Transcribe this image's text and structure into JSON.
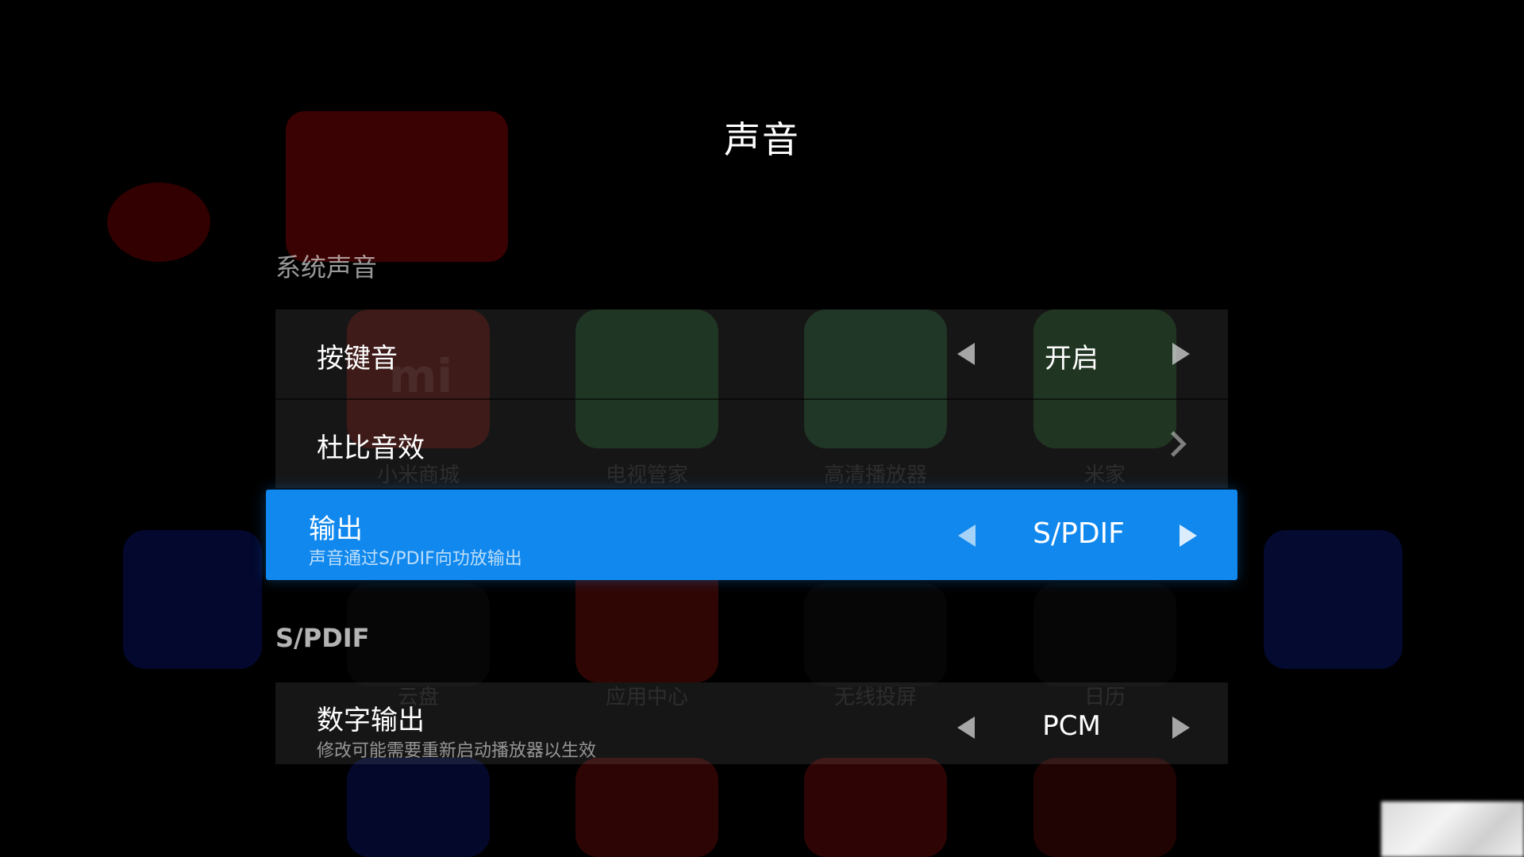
{
  "header": {
    "title": "声音"
  },
  "sections": {
    "system": {
      "title": "系统声音",
      "rows": {
        "key_sound": {
          "label": "按键音",
          "value": "开启"
        },
        "dolby": {
          "label": "杜比音效"
        },
        "output": {
          "label": "输出",
          "subtitle": "声音通过S/PDIF向功放输出",
          "value": "S/PDIF"
        }
      }
    },
    "spdif": {
      "title": "S/PDIF",
      "rows": {
        "digital_output": {
          "label": "数字输出",
          "subtitle": "修改可能需要重新启动播放器以生效",
          "value": "PCM"
        }
      }
    }
  },
  "background_apps": {
    "row1": [
      "小米商城",
      "电视管家",
      "高清播放器",
      "米家"
    ],
    "row2": [
      "云盘",
      "应用中心",
      "无线投屏",
      "日历"
    ]
  },
  "colors": {
    "background": "#000000",
    "focus_highlight": "#1088ee",
    "group_background": "rgba(255,255,255,0.085)"
  },
  "icons": {
    "left_arrow": "left-triangle-arrow-icon",
    "right_arrow": "right-triangle-arrow-icon",
    "chevron": "chevron-right-icon"
  }
}
